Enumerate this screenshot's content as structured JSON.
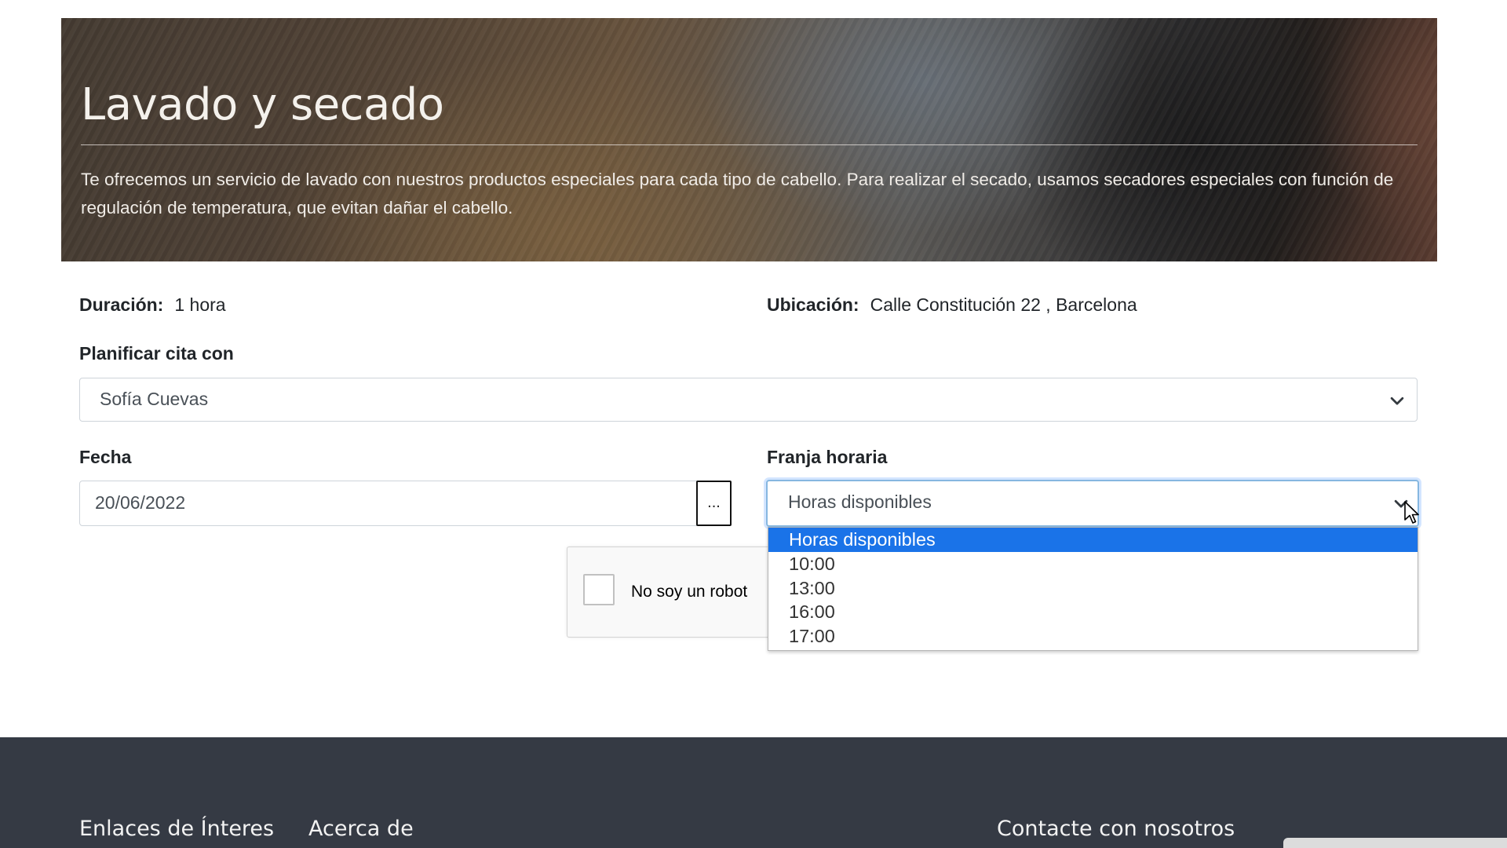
{
  "hero": {
    "title": "Lavado y secado",
    "description": "Te ofrecemos un servicio de lavado con nuestros productos especiales para cada tipo de cabello. Para realizar el secado, usamos secadores especiales con función de regulación de temperatura, que evitan dañar el cabello."
  },
  "info": {
    "duration_label": "Duración:",
    "duration_value": "1 hora",
    "location_label": "Ubicación:",
    "location_value": "Calle Constitución 22 , Barcelona"
  },
  "stylist": {
    "label": "Planificar cita con",
    "selected": "Sofía Cuevas"
  },
  "date": {
    "label": "Fecha",
    "value": "20/06/2022",
    "picker_button": "..."
  },
  "time": {
    "label": "Franja horaria",
    "selected": "Horas disponibles",
    "options": [
      "Horas disponibles",
      "10:00",
      "13:00",
      "16:00",
      "17:00"
    ],
    "highlight_color": "#1a73e8"
  },
  "captcha": {
    "label": "No soy un robot"
  },
  "footer": {
    "links_heading": "Enlaces de Ínteres",
    "about_heading": "Acerca de",
    "contact_heading": "Contacte con nosotros",
    "background": "#353a44"
  },
  "icons": {
    "select_arrow": "chevron-down-icon",
    "pointer": "mouse-cursor-icon"
  }
}
